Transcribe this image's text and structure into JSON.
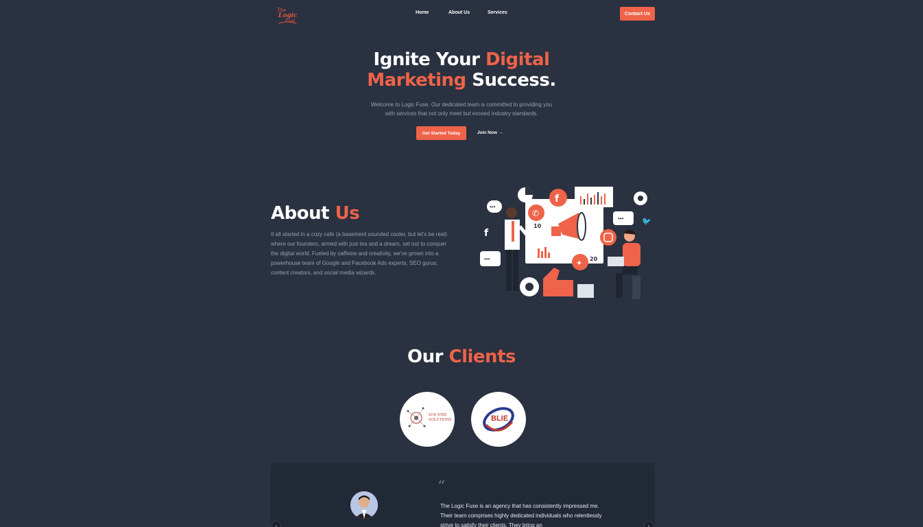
{
  "nav": {
    "logo_text": "The Logic Fuse",
    "links": [
      "Home",
      "About Us",
      "Services"
    ],
    "contact_label": "Contact Us"
  },
  "hero": {
    "title_part1": "Ignite Your ",
    "title_accent1": "Digital",
    "title_accent2": "Marketing",
    "title_part2": " Success.",
    "subtitle_line1": "Welcome to Logic Fuse. Our dedicated team is committed to providing you",
    "subtitle_line2": "with services that not only meet but exceed industry standards.",
    "primary_cta": "Get Started Today",
    "secondary_cta": "Join Now →"
  },
  "about": {
    "title_plain": "About ",
    "title_accent": "Us",
    "body": "It all started in a cozy cafe (a basement sounded cooler, but let's be real) where our founders, armed with just tea and a dream, set out to conquer the digital world. Fueled by caffeine and creativity, we've grown into a powerhouse team of Google and Facebook Ads experts, SEO gurus, content creators, and social media wizards."
  },
  "clients": {
    "title_plain": "Our ",
    "title_accent": "Clients",
    "logos": [
      {
        "name": "EOS WEB SOLUTIONS",
        "line1": "EOS WEB",
        "line2": "SOLUTIONS"
      },
      {
        "name": "BLIE",
        "text": "BLIE"
      }
    ]
  },
  "testimonial": {
    "quote_mark": "“",
    "text": "The Logic Fuse is an agency that has consistently impressed me. Their team comprises highly dedicated individuals who relentlessly strive to satisfy their clients. They bring an",
    "prev_icon": "‹",
    "next_icon": "›"
  },
  "colors": {
    "background": "#2a3140",
    "accent": "#ee6349",
    "muted_text": "#9aa0ab"
  }
}
